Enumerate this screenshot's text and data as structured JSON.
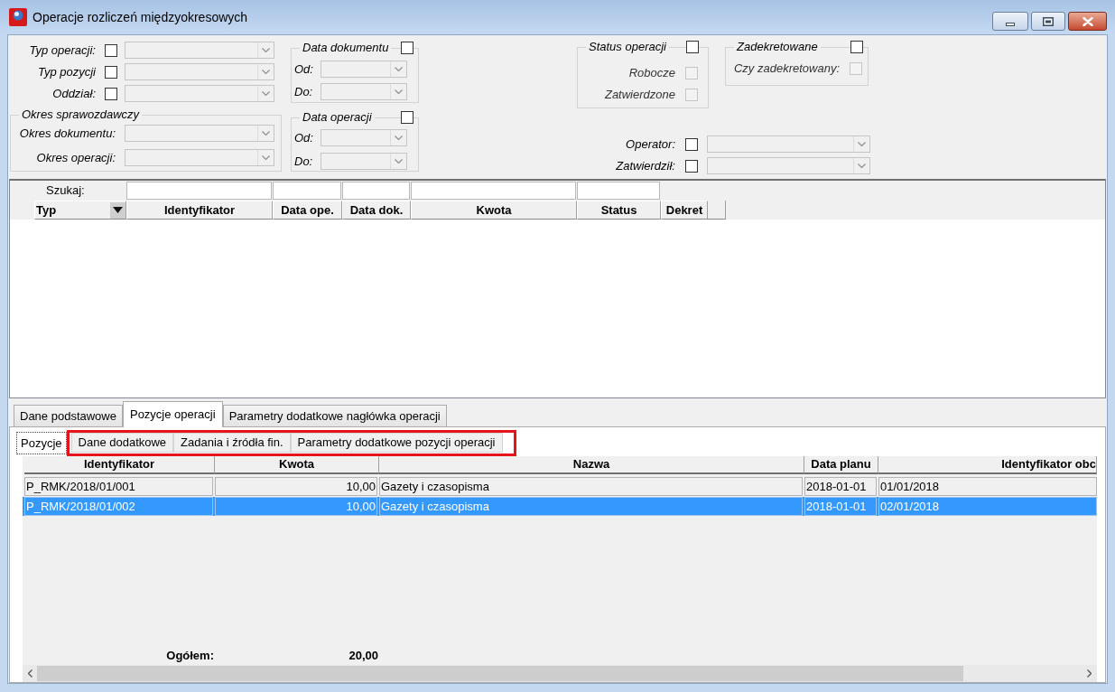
{
  "window": {
    "title": "Operacje rozliczeń międzyokresowych"
  },
  "filters": {
    "main": [
      {
        "label": "Typ operacji:",
        "checked": false
      },
      {
        "label": "Typ pozycji",
        "checked": false
      },
      {
        "label": "Oddział:",
        "checked": false
      }
    ],
    "reporting_period": {
      "title": "Okres sprawozdawczy",
      "fields": [
        {
          "label": "Okres dokumentu:"
        },
        {
          "label": "Okres operacji:"
        }
      ]
    },
    "date_groups": [
      {
        "title": "Data dokumentu",
        "checked": false,
        "fields": [
          {
            "label": "Od:"
          },
          {
            "label": "Do:"
          }
        ]
      },
      {
        "title": "Data operacji",
        "checked": false,
        "fields": [
          {
            "label": "Od:"
          },
          {
            "label": "Do:"
          }
        ]
      }
    ],
    "flag_groups": [
      {
        "title": "Status operacji",
        "checked": false,
        "options": [
          {
            "label": "Robocze",
            "checked": false,
            "disabled": true
          },
          {
            "label": "Zatwierdzone",
            "checked": false,
            "disabled": true
          }
        ]
      },
      {
        "title": "Zadekretowane",
        "checked": false,
        "options": [
          {
            "label": "Czy zadekretowany:",
            "checked": false,
            "disabled": true
          }
        ]
      }
    ],
    "people": [
      {
        "label": "Operator:",
        "checked": false
      },
      {
        "label": "Zatwierdził:",
        "checked": false
      }
    ]
  },
  "operations_grid": {
    "search_label": "Szukaj:",
    "columns": [
      {
        "label": "Typ",
        "kind": "dropdown"
      },
      {
        "label": "Identyfikator",
        "kind": "searchable"
      },
      {
        "label": "Data ope.",
        "kind": "searchable"
      },
      {
        "label": "Data dok.",
        "kind": "searchable"
      },
      {
        "label": "Kwota",
        "kind": "searchable"
      },
      {
        "label": "Status",
        "kind": "searchable"
      },
      {
        "label": "Dekret",
        "kind": "plain"
      }
    ]
  },
  "tabs": [
    {
      "label": "Dane podstawowe",
      "selected": false
    },
    {
      "label": "Pozycje operacji",
      "selected": true
    },
    {
      "label": "Parametry dodatkowe nagłówka operacji",
      "selected": false
    }
  ],
  "subtabs": [
    {
      "label": "Pozycje",
      "selected": true,
      "highlighted": false
    },
    {
      "label": "Dane dodatkowe",
      "selected": false,
      "highlighted": true
    },
    {
      "label": "Zadania i źródła fin.",
      "selected": false,
      "highlighted": true
    },
    {
      "label": "Parametry dodatkowe pozycji operacji",
      "selected": false,
      "highlighted": true
    }
  ],
  "positions": {
    "columns": [
      "Identyfikator",
      "Kwota",
      "Nazwa",
      "Data planu",
      "Identyfikator obc"
    ],
    "rows": [
      {
        "cells": [
          "P_RMK/2018/01/001",
          "10,00",
          "Gazety i czasopisma",
          "2018-01-01",
          "01/01/2018"
        ],
        "selected": false
      },
      {
        "cells": [
          "P_RMK/2018/01/002",
          "10,00",
          "Gazety i czasopisma",
          "2018-01-01",
          "02/01/2018"
        ],
        "selected": true
      }
    ],
    "total": {
      "label": "Ogółem:",
      "value": "20,00"
    }
  }
}
